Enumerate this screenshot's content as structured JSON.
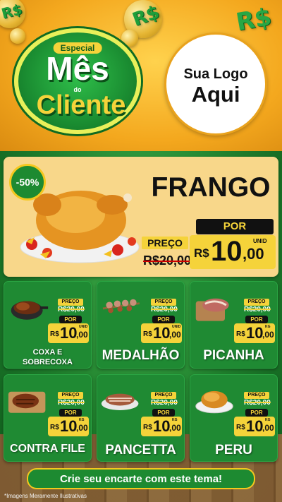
{
  "header": {
    "badge_special": "Especial",
    "badge_line1": "Mês",
    "badge_line2": "do",
    "badge_line3": "Cliente",
    "logo_line1": "Sua Logo",
    "logo_line2": "Aqui",
    "currency_symbol": "R$"
  },
  "featured": {
    "discount": "-50%",
    "title": "FRANGO",
    "preco_label": "PREÇO",
    "old_price": "R$20,00",
    "por_label": "POR",
    "unit": "UNID",
    "currency": "R$",
    "price_int": "10",
    "price_dec": ",00"
  },
  "products": [
    {
      "name1": "COXA E",
      "name2": "SOBRECOXA",
      "preco_label": "PREÇO",
      "old_price": "R$20,00",
      "por_label": "POR",
      "unit": "UNID",
      "currency": "R$",
      "price_int": "10",
      "price_dec": ",00",
      "icon": "drumstick-pan-icon"
    },
    {
      "name1": "MEDALHÃO",
      "name2": "",
      "preco_label": "PREÇO",
      "old_price": "R$20,00",
      "por_label": "POR",
      "unit": "UNID",
      "currency": "R$",
      "price_int": "10",
      "price_dec": ",00",
      "icon": "skewers-icon"
    },
    {
      "name1": "PICANHA",
      "name2": "",
      "preco_label": "PREÇO",
      "old_price": "R$20,00",
      "por_label": "POR",
      "unit": "KG",
      "currency": "R$",
      "price_int": "10",
      "price_dec": ",00",
      "icon": "picanha-icon"
    },
    {
      "name1": "CONTRA FILE",
      "name2": "",
      "preco_label": "PREÇO",
      "old_price": "R$20,00",
      "por_label": "POR",
      "unit": "KG",
      "currency": "R$",
      "price_int": "10",
      "price_dec": ",00",
      "icon": "steak-board-icon"
    },
    {
      "name1": "PANCETTA",
      "name2": "",
      "preco_label": "PREÇO",
      "old_price": "R$20,00",
      "por_label": "POR",
      "unit": "KG",
      "currency": "R$",
      "price_int": "10",
      "price_dec": ",00",
      "icon": "pancetta-icon"
    },
    {
      "name1": "PERU",
      "name2": "",
      "preco_label": "PREÇO",
      "old_price": "R$20,00",
      "por_label": "POR",
      "unit": "KG",
      "currency": "R$",
      "price_int": "10",
      "price_dec": ",00",
      "icon": "turkey-plate-icon"
    }
  ],
  "cta": "Crie seu encarte com este tema!",
  "footnote": "*Imagens Meramente Ilustrativas",
  "colors": {
    "green": "#1f8a33",
    "yellow": "#f5d33a",
    "orange": "#f4a81e",
    "black": "#111111"
  }
}
